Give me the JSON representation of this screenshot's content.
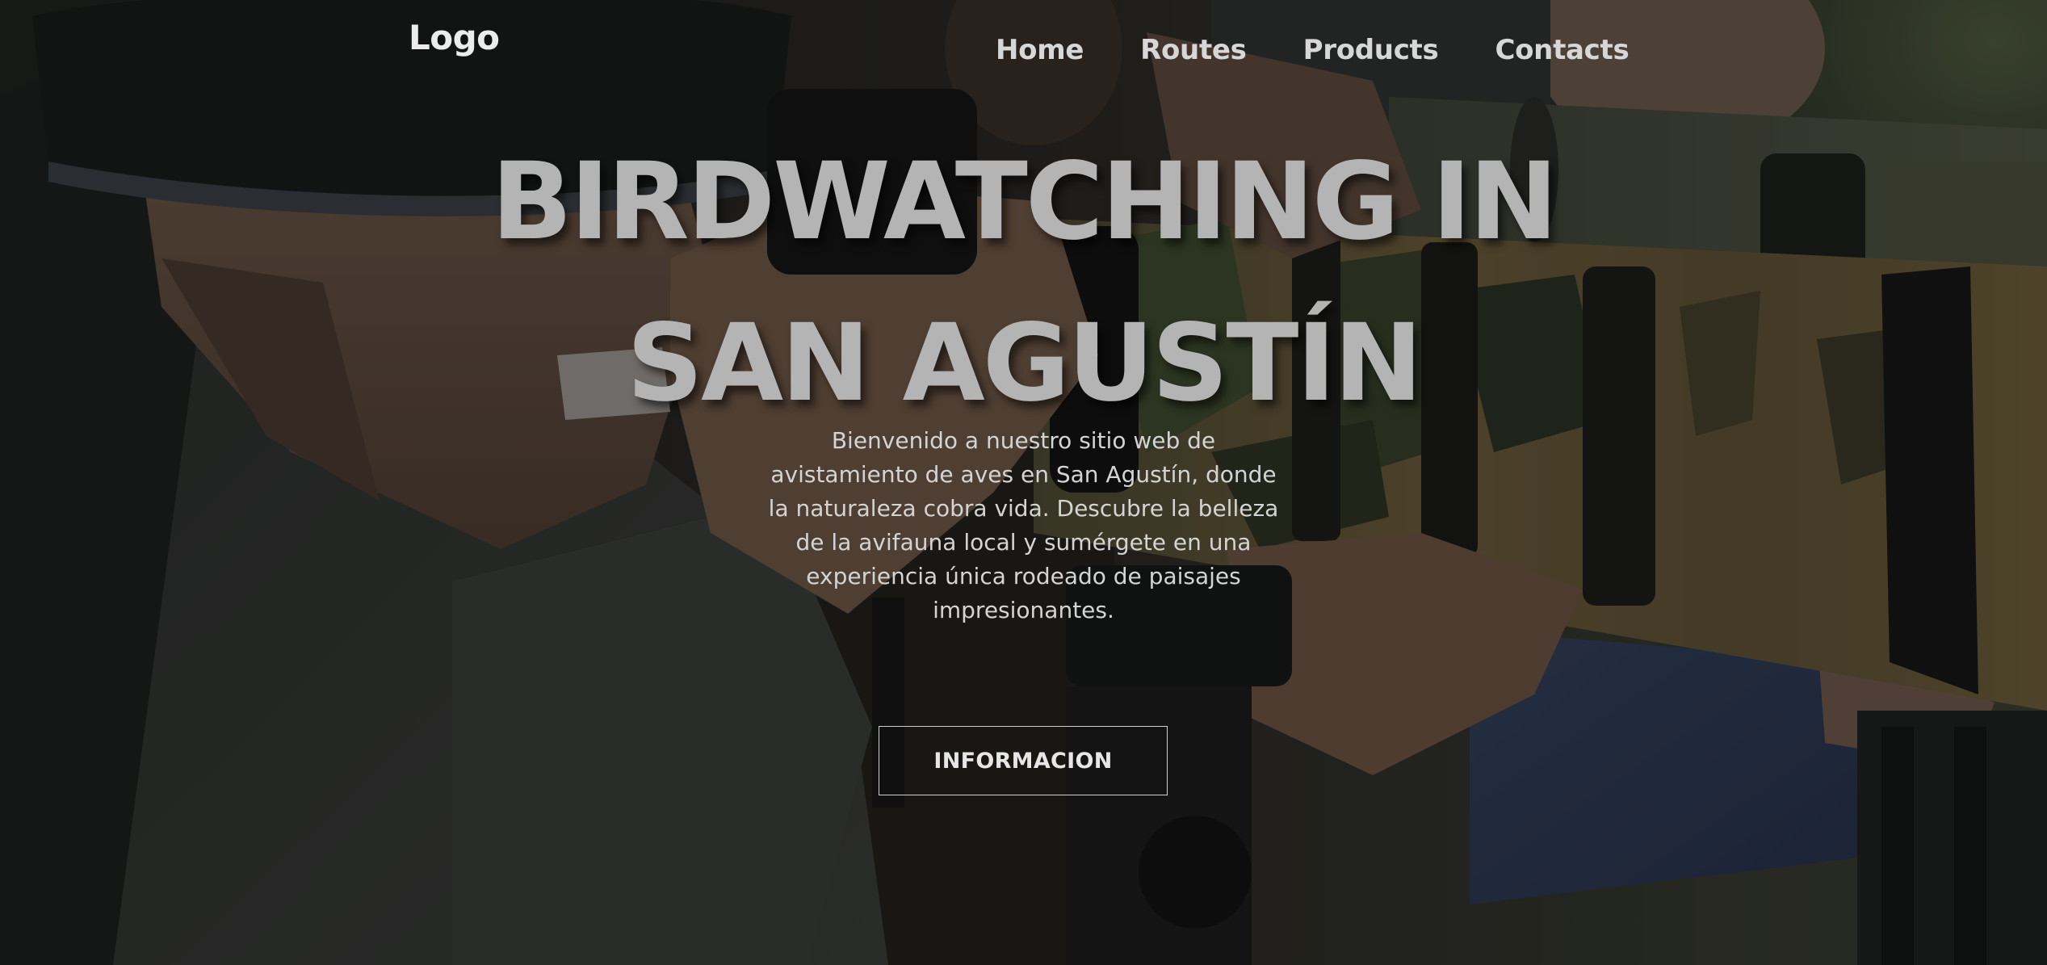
{
  "header": {
    "logo": "Logo",
    "nav": [
      {
        "label": "Home"
      },
      {
        "label": "Routes"
      },
      {
        "label": "Products"
      },
      {
        "label": "Contacts"
      }
    ]
  },
  "hero": {
    "title_line1": "BIRDWATCHING IN",
    "title_line2": "SAN AGUSTÍN",
    "intro": "Bienvenido a nuestro sitio web de avistamiento de aves en San Agustín, donde la naturaleza cobra vida. Descubre la belleza de la avifauna local y sumérgete en una experiencia única rodeado de paisajes impresionantes.",
    "cta_label": "INFORMACION",
    "background_image": "photo of birdwatchers with camouflage telephoto camera lenses"
  },
  "colors": {
    "title": "#b4b4b4",
    "nav_text": "#d7d7d7",
    "overlay": "rgba(0,0,0,0.28)"
  }
}
